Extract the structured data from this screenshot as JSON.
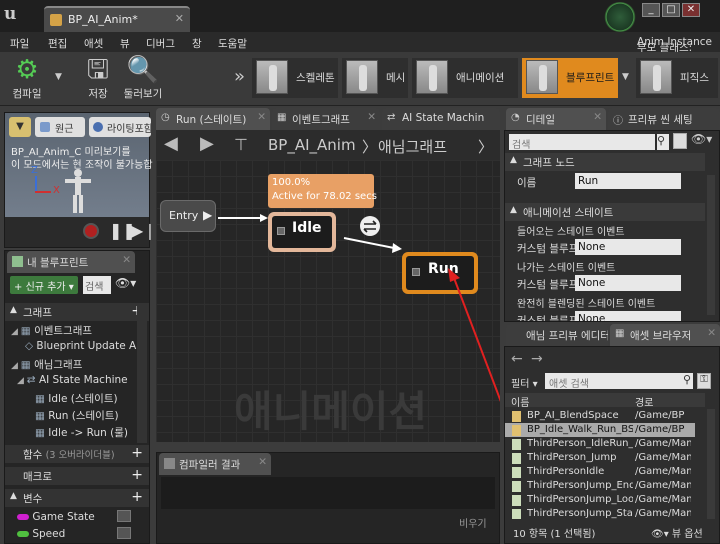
{
  "title_bar": {
    "logo_text": "u",
    "document_tab": "BP_AI_Anim*",
    "window_buttons": [
      "_",
      "□",
      "✕"
    ]
  },
  "menu": {
    "items": [
      "파일",
      "편집",
      "애셋",
      "뷰",
      "디버그",
      "창",
      "도움말"
    ],
    "parent_class_label": "부모 클래스:",
    "parent_class_value": "Anim Instance"
  },
  "toolbar": {
    "compile": "컴파일",
    "save": "저장",
    "browse": "둘러보기",
    "modes": [
      "스켈레톤",
      "메시",
      "애니메이션",
      "블루프린트",
      "피직스"
    ],
    "active_mode": "블루프린트"
  },
  "preview": {
    "view_button": "원근",
    "lighting_button": "라이팅포함",
    "info_line1": "BP_AI_Anim_C 미리보기를",
    "info_line2": "이 모드에서는 현 조작이 불가능합",
    "axis_z": "Z",
    "axis_x": "X"
  },
  "my_blueprint": {
    "tab": "내 블루프린트",
    "add_button": "신규 추가",
    "search_placeholder": "검색",
    "graphs_header": "그래프",
    "event_graph": "이벤트그래프",
    "blueprint_update": "Blueprint Update A",
    "anim_graph": "애님그래프",
    "state_machine": "AI State Machine",
    "state_idle": "Idle (스테이트)",
    "state_run": "Run (스테이트)",
    "transition": "Idle -> Run (룰)",
    "functions_header": "함수",
    "functions_count": "(3 오버라이더블)",
    "macros_header": "매크로",
    "variables_header": "변수",
    "var_game_state": "Game State",
    "var_speed": "Speed"
  },
  "graph_editor": {
    "tabs": [
      "Run (스테이트)",
      "이벤트그래프",
      "AI State Machin"
    ],
    "breadcrumb_root": "BP_AI_Anim",
    "breadcrumb_sep": "〉",
    "breadcrumb_child": "애님그래프",
    "watermark": "애니메이션",
    "entry_node": "Entry",
    "idle_node": "Idle",
    "run_node": "Run",
    "idle_status_percent": "100.0%",
    "idle_status_active": "Active for 78.02 secs"
  },
  "compiler": {
    "tab": "컴파일러 결과",
    "clear": "비우기"
  },
  "details": {
    "tab1": "디테일",
    "tab2": "프리뷰 씬 세팅",
    "search_placeholder": "검색",
    "graph_node_header": "그래프 노드",
    "name_label": "이름",
    "name_value": "Run",
    "anim_state_header": "애니메이션 스테이트",
    "entered_event": "들어오는 스테이트 이벤트",
    "custom_bp_label": "커스텀 블루프",
    "custom_bp_value": "None",
    "left_event": "나가는 스테이트 이벤트",
    "fully_blended_event": "완전히 블렌딩된 스테이트 이벤트"
  },
  "content_browser": {
    "tab1": "애님 프리뷰 에디터",
    "tab2": "애셋 브라우저",
    "filter_label": "필터",
    "search_placeholder": "애셋 검색",
    "col_name": "이름",
    "col_path": "경로",
    "assets": [
      {
        "name": "BP_AI_BlendSpace",
        "path": "/Game/BP"
      },
      {
        "name": "BP_Idle_Walk_Run_BS",
        "path": "/Game/BP"
      },
      {
        "name": "ThirdPerson_IdleRun_2",
        "path": "/Game/Mann"
      },
      {
        "name": "ThirdPerson_Jump",
        "path": "/Game/Mann"
      },
      {
        "name": "ThirdPersonIdle",
        "path": "/Game/Mann"
      },
      {
        "name": "ThirdPersonJump_End",
        "path": "/Game/Mann"
      },
      {
        "name": "ThirdPersonJump_Loop",
        "path": "/Game/Mann"
      },
      {
        "name": "ThirdPersonJump_Start",
        "path": "/Game/Mann"
      }
    ],
    "selected_asset": "BP_Idle_Walk_Run_BS",
    "status": "10 항목 (1 선택됨)",
    "view_options": "뷰 옵션"
  },
  "colors": {
    "accent_orange": "#e08a1e",
    "idle_node": "#e3b79a",
    "status_box": "#e8a065",
    "annotation_arrow": "#e02020",
    "var_game_state": "#d020d0",
    "var_speed": "#50c040"
  }
}
